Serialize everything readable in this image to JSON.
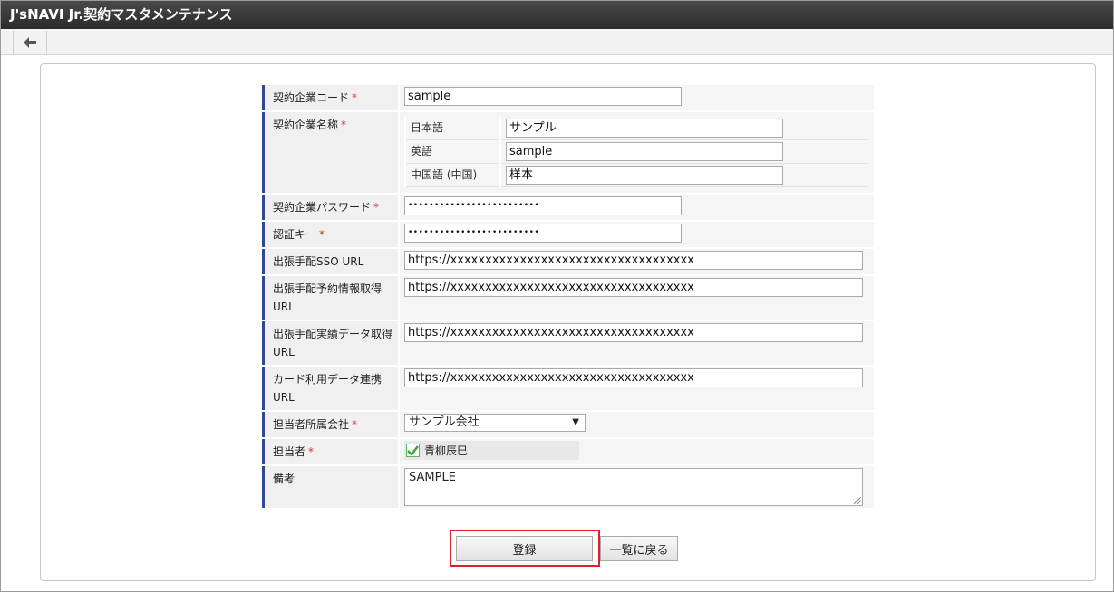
{
  "window": {
    "title": "J'sNAVI Jr.契約マスタメンテナンス"
  },
  "toolbar": {
    "back_icon": "arrow-left-icon"
  },
  "form": {
    "required_mark": "*",
    "company_code": {
      "label": "契約企業コード",
      "value": "sample"
    },
    "company_name": {
      "label": "契約企業名称",
      "languages": [
        {
          "lang": "日本語",
          "value": "サンプル"
        },
        {
          "lang": "英語",
          "value": "sample"
        },
        {
          "lang": "中国語 (中国)",
          "value": "样本"
        }
      ]
    },
    "password": {
      "label": "契約企業パスワード",
      "value": "•••••••••••••••••••••••••"
    },
    "auth_key": {
      "label": "認証キー",
      "value": "•••••••••••••••••••••••••"
    },
    "sso_url": {
      "label": "出張手配SSO URL",
      "value": "https://xxxxxxxxxxxxxxxxxxxxxxxxxxxxxxxxxxx"
    },
    "reservation_url": {
      "label": "出張手配予約情報取得URL",
      "value": "https://xxxxxxxxxxxxxxxxxxxxxxxxxxxxxxxxxxx"
    },
    "results_url": {
      "label": "出張手配実績データ取得URL",
      "value": "https://xxxxxxxxxxxxxxxxxxxxxxxxxxxxxxxxxxx"
    },
    "card_url": {
      "label": "カード利用データ連携URL",
      "value": "https://xxxxxxxxxxxxxxxxxxxxxxxxxxxxxxxxxxx"
    },
    "company": {
      "label": "担当者所属会社",
      "value": "サンプル会社"
    },
    "person": {
      "label": "担当者",
      "value": "青柳辰巳",
      "checked": true
    },
    "remarks": {
      "label": "備考",
      "value": "SAMPLE"
    }
  },
  "buttons": {
    "register": "登録",
    "back_to_list": "一覧に戻る"
  },
  "colors": {
    "accent_bar": "#2e4a8c",
    "required": "#c0392b",
    "highlight": "#e0202a",
    "check": "#5cb85c"
  }
}
